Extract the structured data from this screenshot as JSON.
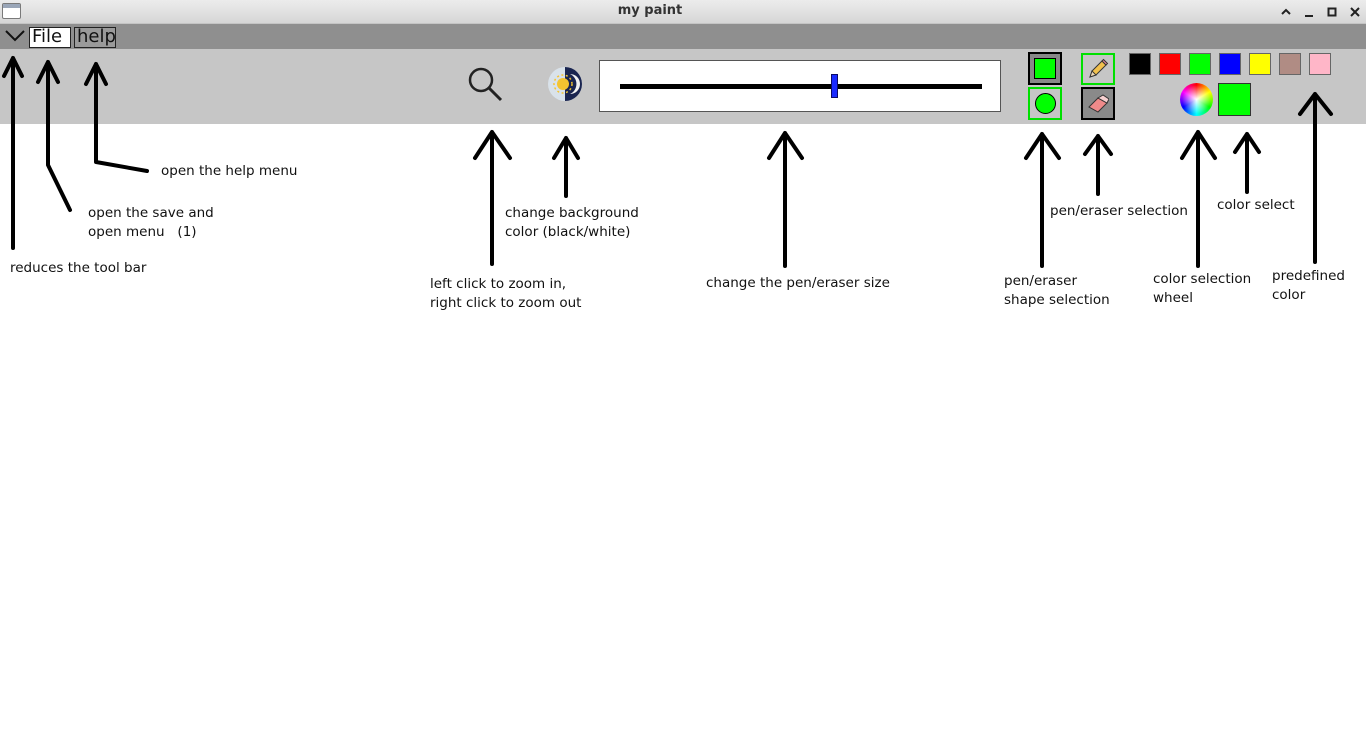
{
  "window": {
    "title": "my paint",
    "controls": [
      "chevron-up-icon",
      "minimize-icon",
      "maximize-icon",
      "close-icon"
    ]
  },
  "menubar": {
    "collapse_icon": "chevron-down-icon",
    "file_label": "File",
    "help_label": "help"
  },
  "toolbar": {
    "zoom_icon": "magnifier-icon",
    "background_icon": "sun-moon-icon",
    "size_slider_value": 0.59,
    "shapes": [
      "square",
      "circle"
    ],
    "tools": [
      "pencil-icon",
      "eraser-icon"
    ],
    "active_color": "#00ff00",
    "palette": [
      "#000000",
      "#ff0000",
      "#00ff00",
      "#0000ff",
      "#ffff00",
      "#b08c84",
      "#ffb6c8"
    ],
    "color_wheel_icon": "color-wheel-icon"
  },
  "annotations": {
    "reduce_toolbar": "reduces the tool bar",
    "file_menu": "open the save and\nopen menu   (1)",
    "help_menu": "open the help menu",
    "zoom": "left click to zoom in,\nright click to zoom out",
    "background": "change background\ncolor (black/white)",
    "size": "change the pen/eraser size",
    "shape": "pen/eraser\nshape selection",
    "pen_eraser": "pen/eraser selection",
    "wheel": "color selection\nwheel",
    "color_select": "color select",
    "predefined": "predefined\ncolor"
  }
}
